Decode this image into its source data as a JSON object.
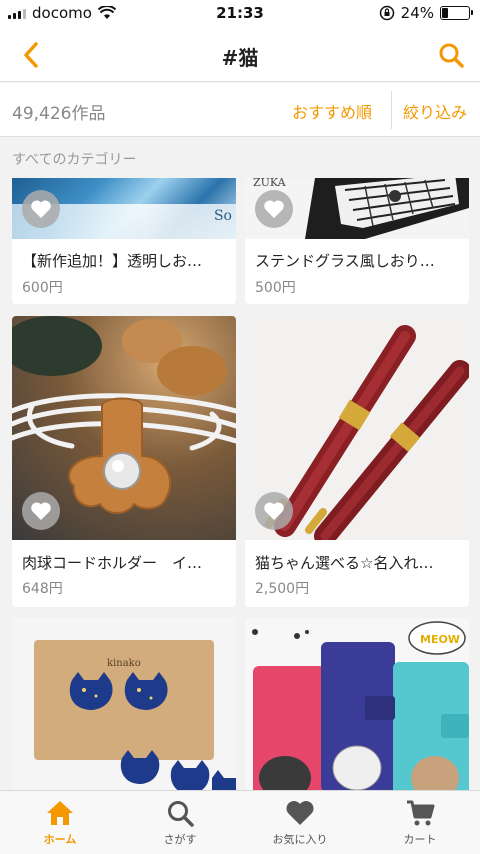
{
  "status": {
    "carrier": "docomo",
    "time": "21:33",
    "battery_text": "24%",
    "battery_level": 0.24
  },
  "nav": {
    "title": "#猫"
  },
  "filter": {
    "count": "49,426作品",
    "sort_label": "おすすめ順",
    "narrow_label": "絞り込み"
  },
  "category_label": "すべてのカテゴリー",
  "products": [
    {
      "name": "【新作追加！】透明しお…",
      "price": "600円"
    },
    {
      "name": "ステンドグラス風しおり…",
      "price": "500円"
    },
    {
      "name": "肉球コードホルダー　イ…",
      "price": "648円"
    },
    {
      "name": "猫ちゃん選べる☆名入れ…",
      "price": "2,500円"
    }
  ],
  "tabs": [
    {
      "label": "ホーム",
      "icon": "home-icon",
      "active": true
    },
    {
      "label": "さがす",
      "icon": "search-icon",
      "active": false
    },
    {
      "label": "お気に入り",
      "icon": "heart-icon",
      "active": false
    },
    {
      "label": "カート",
      "icon": "cart-icon",
      "active": false
    }
  ],
  "colors": {
    "accent": "#f39800",
    "background": "#f2f2f2"
  }
}
